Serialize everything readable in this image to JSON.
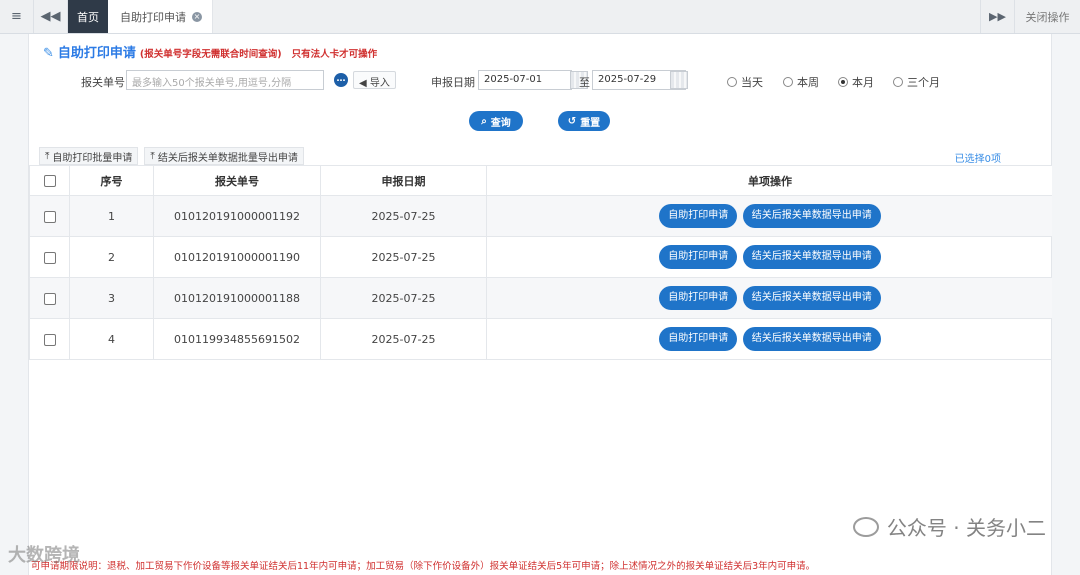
{
  "topbar": {
    "menu_icon": "menu-icon",
    "prev_icon": "double-left-arrow-icon",
    "home_tab": "首页",
    "active_tab": "自助打印申请",
    "next_icon": "double-right-arrow-icon",
    "close_ops": "关闭操作"
  },
  "page": {
    "title": "自助打印申请",
    "note1": "(报关单号字段无需联合时间查询)",
    "note2": "只有法人卡才可操作"
  },
  "form": {
    "decl_label": "报关单号",
    "decl_placeholder": "最多输入50个报关单号,用逗号,分隔",
    "more_icon": "…",
    "import_label": "导入",
    "date_label": "申报日期",
    "date_from": "2025-07-01",
    "to_label": "至",
    "date_to": "2025-07-29",
    "radios": [
      {
        "label": "当天",
        "selected": false
      },
      {
        "label": "本周",
        "selected": false
      },
      {
        "label": "本月",
        "selected": true
      },
      {
        "label": "三个月",
        "selected": false
      }
    ]
  },
  "buttons": {
    "search": "查询",
    "reset": "重置"
  },
  "toolbar": {
    "batch_print": "自助打印批量申请",
    "batch_export": "结关后报关单数据批量导出申请",
    "selected": "已选择0项"
  },
  "table": {
    "headers": [
      "序号",
      "报关单号",
      "申报日期",
      "单项操作"
    ],
    "op_print": "自助打印申请",
    "op_export": "结关后报关单数据导出申请",
    "rows": [
      {
        "seq": "1",
        "decl_no": "010120191000001192",
        "date": "2025-07-25"
      },
      {
        "seq": "2",
        "decl_no": "010120191000001190",
        "date": "2025-07-25"
      },
      {
        "seq": "3",
        "decl_no": "010120191000001188",
        "date": "2025-07-25"
      },
      {
        "seq": "4",
        "decl_no": "010119934855691502",
        "date": "2025-07-25"
      }
    ]
  },
  "footer": {
    "note": "可申请期限说明：退税、加工贸易下作价设备等报关单证结关后11年内可申请；加工贸易（除下作价设备外）报关单证结关后5年可申请；除上述情况之外的报关单证结关后3年内可申请。"
  },
  "watermarks": {
    "left": "大数跨境",
    "right": "公众号 · 关务小二"
  },
  "colors": {
    "accent": "#1f74c9",
    "title": "#2c7be5",
    "warning": "#d0302f"
  }
}
